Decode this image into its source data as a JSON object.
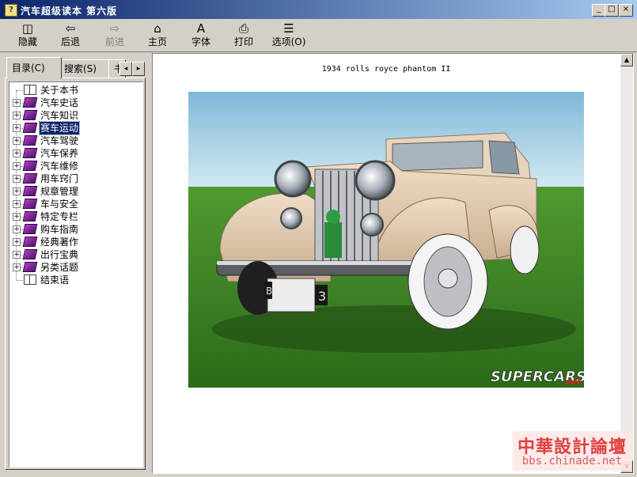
{
  "window": {
    "title": "汽车超级读本  第六版",
    "controls": {
      "minimize": "_",
      "maximize": "□",
      "close": "×"
    }
  },
  "toolbar": {
    "items": [
      {
        "label": "隐藏",
        "icon": "hide-icon",
        "glyph": "◫"
      },
      {
        "label": "后退",
        "icon": "back-arrow-icon",
        "glyph": "⇦"
      },
      {
        "label": "前进",
        "icon": "forward-arrow-icon",
        "glyph": "⇨"
      },
      {
        "label": "主页",
        "icon": "home-icon",
        "glyph": "⌂"
      },
      {
        "label": "字体",
        "icon": "font-icon",
        "glyph": "A"
      },
      {
        "label": "打印",
        "icon": "print-icon",
        "glyph": "⎙"
      },
      {
        "label": "选项(O)",
        "icon": "options-icon",
        "glyph": "☰"
      }
    ]
  },
  "nav": {
    "tabs": [
      {
        "label": "目录(C)"
      },
      {
        "label": "搜索(S)"
      },
      {
        "label": "书"
      }
    ],
    "scroll_left": "◂",
    "scroll_right": "▸",
    "tree": [
      {
        "label": "关于本书",
        "type": "page"
      },
      {
        "label": "汽车史话",
        "type": "book"
      },
      {
        "label": "汽车知识",
        "type": "book"
      },
      {
        "label": "赛车运动",
        "type": "book",
        "selected": true
      },
      {
        "label": "汽车驾驶",
        "type": "book"
      },
      {
        "label": "汽车保养",
        "type": "book"
      },
      {
        "label": "汽车维修",
        "type": "book"
      },
      {
        "label": "用车窍门",
        "type": "book"
      },
      {
        "label": "规章管理",
        "type": "book"
      },
      {
        "label": "车与安全",
        "type": "book"
      },
      {
        "label": "特定专栏",
        "type": "book"
      },
      {
        "label": "购车指南",
        "type": "book"
      },
      {
        "label": "经典著作",
        "type": "book"
      },
      {
        "label": "出行宝典",
        "type": "book"
      },
      {
        "label": "另类话题",
        "type": "book"
      },
      {
        "label": "结束语",
        "type": "page"
      }
    ],
    "expander": "+"
  },
  "content": {
    "caption": "1934 rolls royce phantom II",
    "photo_logo": "SUPERCARS",
    "photo_logo_suffix": "net",
    "plate_left": "B",
    "plate_right": "3"
  },
  "scroll": {
    "up": "▲",
    "down": "▼"
  },
  "watermark": {
    "line1": "中華設計論壇",
    "line2": "bbs.chinade.net"
  }
}
